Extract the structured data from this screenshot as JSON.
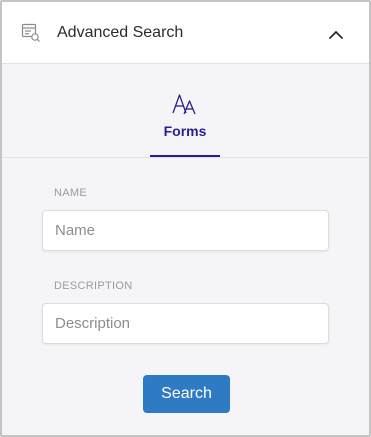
{
  "header": {
    "title": "Advanced Search",
    "icon": "search-list-icon",
    "collapse_icon": "chevron-up-icon"
  },
  "tabs": [
    {
      "label": "Forms",
      "icon": "font-forms-icon",
      "active": true
    }
  ],
  "fields": {
    "name": {
      "label": "NAME",
      "placeholder": "Name",
      "value": ""
    },
    "description": {
      "label": "DESCRIPTION",
      "placeholder": "Description",
      "value": ""
    }
  },
  "actions": {
    "search_label": "Search"
  },
  "colors": {
    "accent": "#2a1f8f",
    "button": "#2e7bc4",
    "panel_bg": "#f5f5f7"
  }
}
